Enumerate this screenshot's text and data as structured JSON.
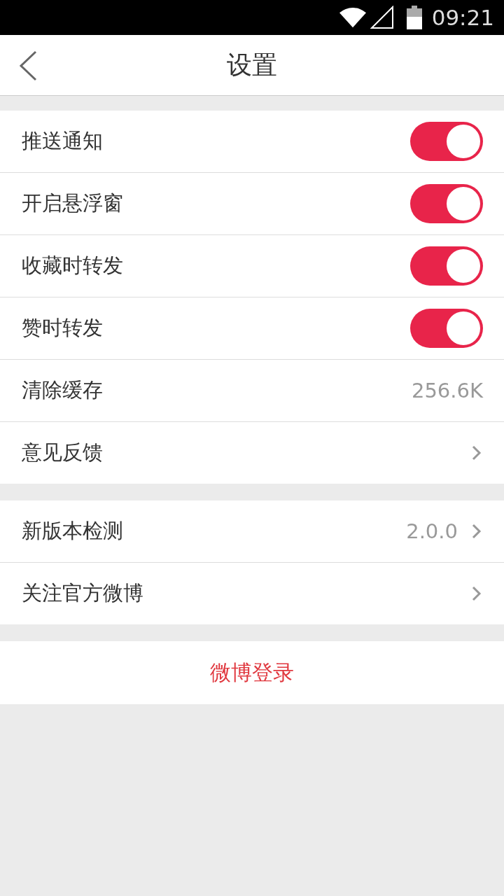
{
  "status_bar": {
    "time": "09:21"
  },
  "header": {
    "title": "设置"
  },
  "sections": [
    {
      "items": [
        {
          "kind": "toggle",
          "label": "推送通知",
          "on": true
        },
        {
          "kind": "toggle",
          "label": "开启悬浮窗",
          "on": true
        },
        {
          "kind": "toggle",
          "label": "收藏时转发",
          "on": true
        },
        {
          "kind": "toggle",
          "label": "赞时转发",
          "on": true
        },
        {
          "kind": "value",
          "label": "清除缓存",
          "value": "256.6K"
        },
        {
          "kind": "link",
          "label": "意见反馈"
        }
      ]
    },
    {
      "items": [
        {
          "kind": "link",
          "label": "新版本检测",
          "value": "2.0.0"
        },
        {
          "kind": "link",
          "label": "关注官方微博"
        }
      ]
    }
  ],
  "login_button": "微博登录"
}
